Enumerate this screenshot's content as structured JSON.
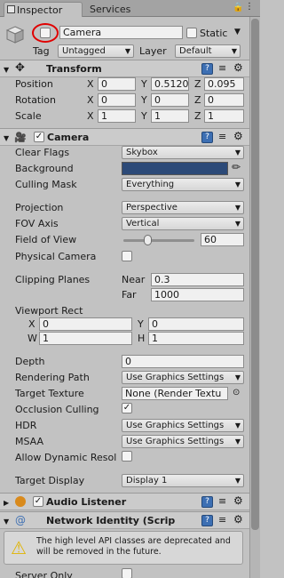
{
  "tabs": {
    "inspector": "Inspector",
    "services": "Services"
  },
  "object": {
    "name": "Camera",
    "static_label": "Static",
    "tag_label": "Tag",
    "tag_value": "Untagged",
    "layer_label": "Layer",
    "layer_value": "Default"
  },
  "transform": {
    "title": "Transform",
    "position": {
      "label": "Position",
      "x": "0",
      "y": "0.5120",
      "z": "0.095"
    },
    "rotation": {
      "label": "Rotation",
      "x": "0",
      "y": "0",
      "z": "0"
    },
    "scale": {
      "label": "Scale",
      "x": "1",
      "y": "1",
      "z": "1"
    }
  },
  "axes": {
    "x": "X",
    "y": "Y",
    "z": "Z",
    "w": "W",
    "h": "H"
  },
  "camera": {
    "title": "Camera",
    "clear_flags": {
      "label": "Clear Flags",
      "value": "Skybox"
    },
    "background": {
      "label": "Background",
      "color": "#2c4a78"
    },
    "culling_mask": {
      "label": "Culling Mask",
      "value": "Everything"
    },
    "projection": {
      "label": "Projection",
      "value": "Perspective"
    },
    "fov_axis": {
      "label": "FOV Axis",
      "value": "Vertical"
    },
    "field_of_view": {
      "label": "Field of View",
      "value": "60",
      "slider_fraction": 0.34
    },
    "physical_camera": {
      "label": "Physical Camera"
    },
    "clipping_planes": {
      "label": "Clipping Planes",
      "near_label": "Near",
      "near": "0.3",
      "far_label": "Far",
      "far": "1000"
    },
    "viewport_rect": {
      "label": "Viewport Rect",
      "x": "0",
      "y": "0",
      "w": "1",
      "h": "1"
    },
    "depth": {
      "label": "Depth",
      "value": "0"
    },
    "rendering_path": {
      "label": "Rendering Path",
      "value": "Use Graphics Settings"
    },
    "target_texture": {
      "label": "Target Texture",
      "value": "None (Render Textu"
    },
    "occlusion_culling": {
      "label": "Occlusion Culling"
    },
    "hdr": {
      "label": "HDR",
      "value": "Use Graphics Settings"
    },
    "msaa": {
      "label": "MSAA",
      "value": "Use Graphics Settings"
    },
    "allow_dynamic": {
      "label": "Allow Dynamic Resol"
    },
    "target_display": {
      "label": "Target Display",
      "value": "Display 1"
    }
  },
  "audio_listener": {
    "title": "Audio Listener"
  },
  "network_identity": {
    "title": "Network Identity (Scrip",
    "warning": "The high level API classes are deprecated and will be removed in the future.",
    "server_only": "Server Only"
  },
  "colors": {
    "highlight_ring": "#e00000",
    "accent_blue": "#3d6fb3"
  }
}
